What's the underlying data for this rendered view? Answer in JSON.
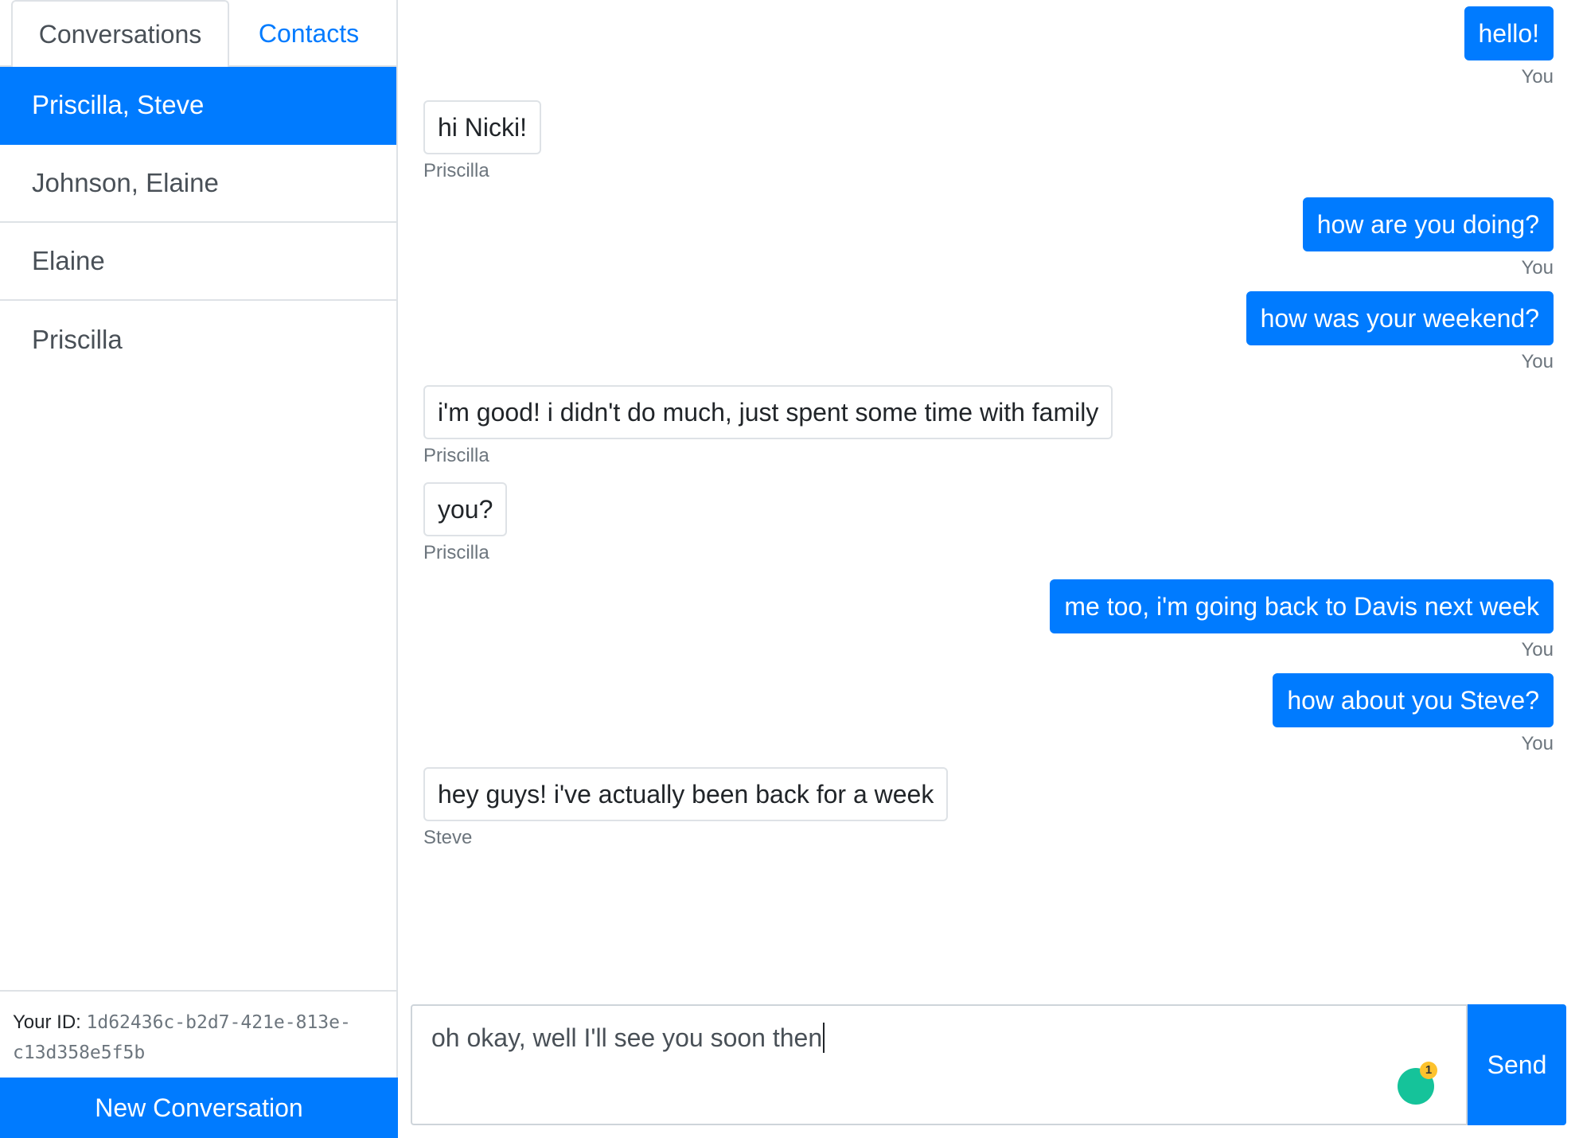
{
  "sidebar": {
    "tabs": [
      {
        "label": "Conversations",
        "active": true
      },
      {
        "label": "Contacts",
        "active": false
      }
    ],
    "conversations": [
      {
        "label": "Priscilla, Steve",
        "active": true
      },
      {
        "label": "Johnson, Elaine",
        "active": false
      },
      {
        "label": "Elaine",
        "active": false
      },
      {
        "label": "Priscilla",
        "active": false
      }
    ],
    "your_id_label": "Your ID:",
    "your_id_value": "1d62436c-b2d7-421e-813e-c13d358e5f5b",
    "new_conversation_label": "New Conversation"
  },
  "chat": {
    "messages": [
      {
        "text": "hello!",
        "sender": "You",
        "mine": true
      },
      {
        "text": "hi Nicki!",
        "sender": "Priscilla",
        "mine": false
      },
      {
        "text": "how are you doing?",
        "sender": "You",
        "mine": true
      },
      {
        "text": "how was your weekend?",
        "sender": "You",
        "mine": true
      },
      {
        "text": "i'm good! i didn't do much, just spent some time with family",
        "sender": "Priscilla",
        "mine": false
      },
      {
        "text": "you?",
        "sender": "Priscilla",
        "mine": false
      },
      {
        "text": "me too, i'm going back to Davis next week",
        "sender": "You",
        "mine": true
      },
      {
        "text": "how about you Steve?",
        "sender": "You",
        "mine": true
      },
      {
        "text": "hey guys! i've actually been back for a week",
        "sender": "Steve",
        "mine": false
      }
    ]
  },
  "composer": {
    "value": "oh okay, well I'll see you soon then",
    "grammarly_count": "1",
    "send_label": "Send"
  },
  "colors": {
    "primary": "#007bff",
    "grammarly": "#15c39a",
    "grammarly_badge": "#fdc22d"
  }
}
